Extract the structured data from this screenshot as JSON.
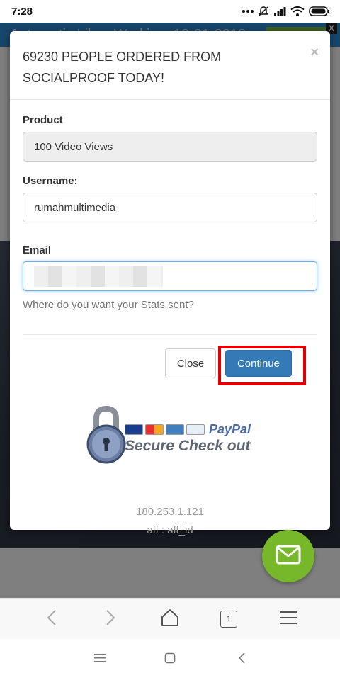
{
  "status_bar": {
    "time": "7:28",
    "icons": [
      "more-dots-icon",
      "notifications-off-icon",
      "cell-signal-icon",
      "wifi-icon",
      "battery-icon"
    ]
  },
  "background_page": {
    "banner_text": "Automatic Likes Working: 12-01-2018",
    "banner_close": "X",
    "mail_button_icon": "mail-icon"
  },
  "modal": {
    "title": "69230 PEOPLE ORDERED FROM SOCIALPROOF TODAY!",
    "close_symbol": "×",
    "product_label": "Product",
    "product_value": "100 Video Views",
    "username_label": "Username:",
    "username_value": "rumahmultimedia",
    "email_label": "Email",
    "email_help": "Where do you want your Stats sent?",
    "close_button": "Close",
    "continue_button": "Continue",
    "secure_badge": {
      "brand": "PayPal",
      "text": "Secure Check out"
    },
    "ip_address": "180.253.1.121",
    "affiliate": "aff : aff_id"
  },
  "browser_bar": {
    "tab_count": "1",
    "icons": [
      "back-icon",
      "forward-icon",
      "home-icon",
      "tabs-icon",
      "menu-icon"
    ]
  },
  "colors": {
    "primary": "#337ab7",
    "fab": "#77b82a",
    "highlight": "#e00000"
  }
}
